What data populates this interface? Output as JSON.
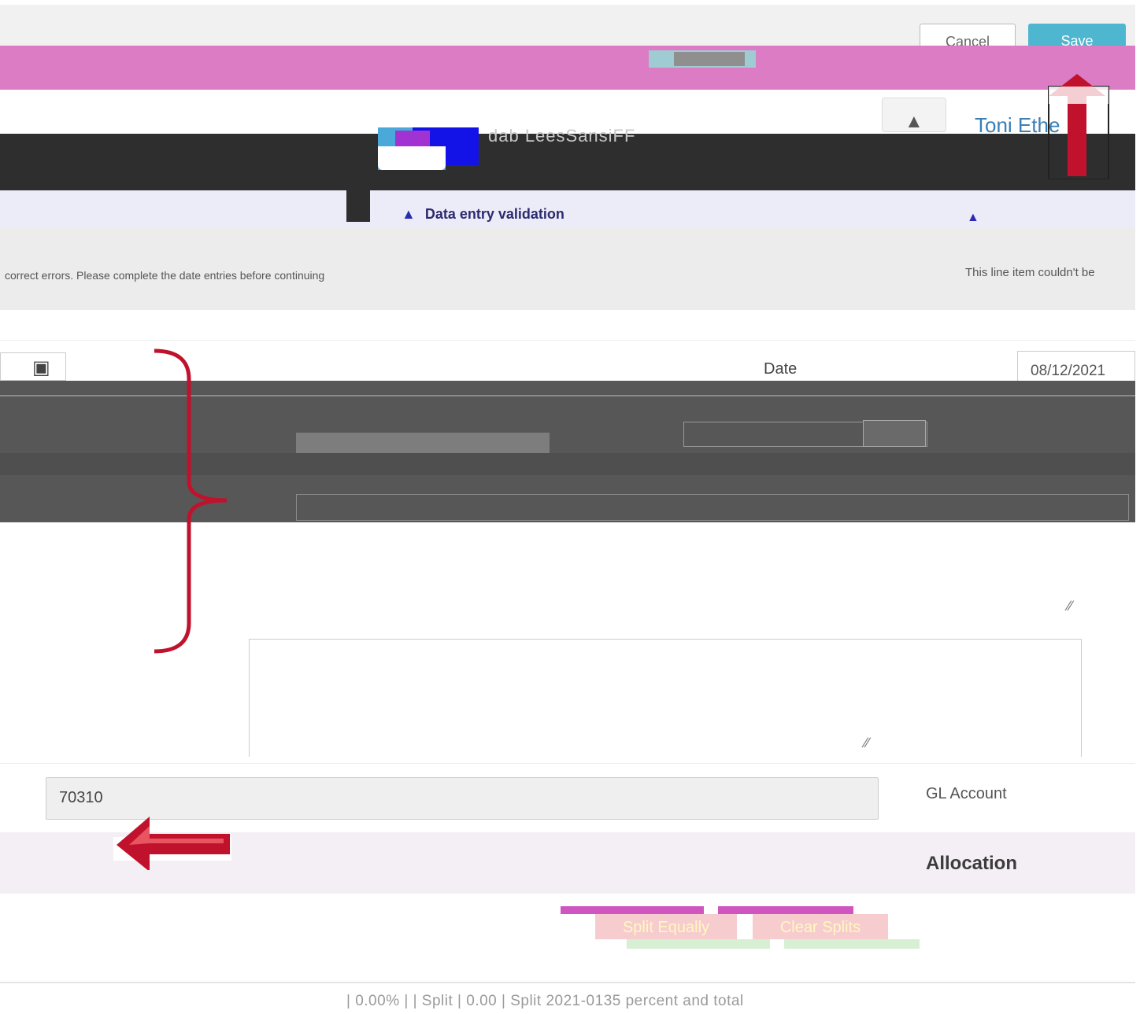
{
  "toolbar": {
    "cancel_label": "Cancel",
    "save_label": "Save"
  },
  "header": {
    "user_name": "Toni Ethe",
    "app_title": "dab LeesSansiFF"
  },
  "validation": {
    "title": "Data entry validation",
    "message_left": "correct errors. Please complete the date entries before continuing",
    "message_right": "This line item couldn't be"
  },
  "date_field": {
    "label": "Date",
    "value": "08/12/2021"
  },
  "gl_account": {
    "label": "GL Account",
    "value": "70310"
  },
  "allocation": {
    "title": "Allocation",
    "split_equally_label": "Split Equally",
    "clear_splits_label": "Clear Splits"
  },
  "footer": {
    "text": "| 0.00% | | Split | 0.00 | Split 2021-0135 percent and total"
  },
  "colors": {
    "save_button": "#4fb6cf",
    "annotation_pink": "#dc7cc4",
    "arrow_red": "#c0122c",
    "allocation_bg": "#f4eff4"
  },
  "icons": {
    "calendar": "calendar-icon",
    "tray": "tray-icon"
  }
}
